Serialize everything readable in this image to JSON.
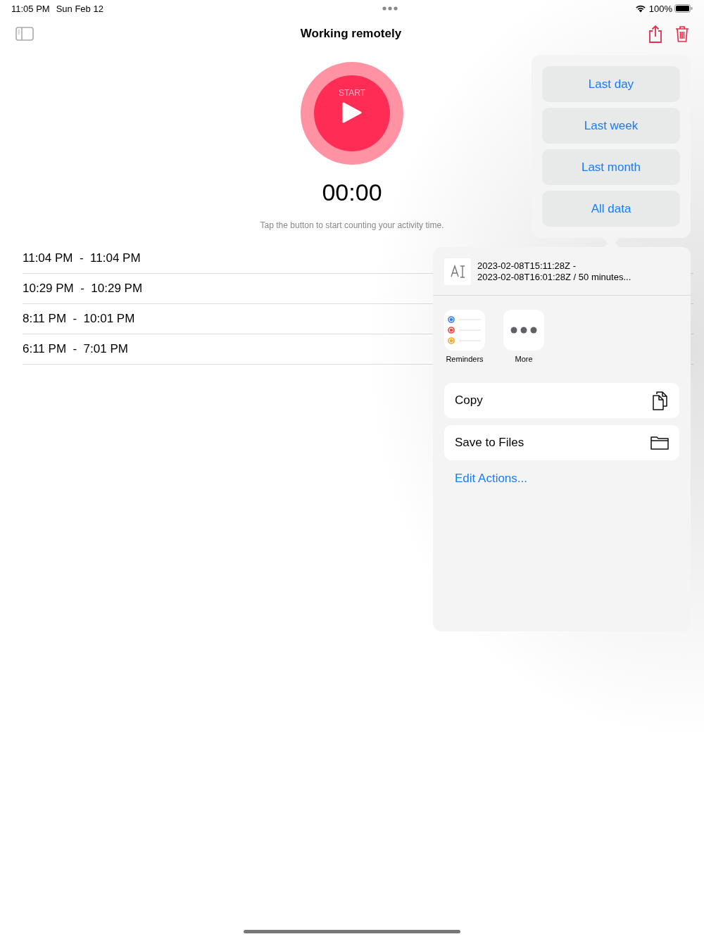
{
  "status_bar": {
    "time": "11:05 PM",
    "date": "Sun Feb 12",
    "battery": "100%"
  },
  "nav": {
    "title": "Working remotely"
  },
  "timer": {
    "button_label": "START",
    "elapsed": "00:00",
    "hint": "Tap the button to start counting your activity time."
  },
  "sessions": [
    {
      "label": "11:04 PM  -  11:04 PM"
    },
    {
      "label": "10:29 PM  -  10:29 PM"
    },
    {
      "label": "8:11 PM  -  10:01 PM"
    },
    {
      "label": "6:11 PM  -  7:01 PM"
    }
  ],
  "export_menu": {
    "options": [
      "Last day",
      "Last week",
      "Last month",
      "All data"
    ]
  },
  "share_sheet": {
    "preview_lines": [
      "2023-02-08T15:11:28Z -",
      "2023-02-08T16:01:28Z / 50 minutes..."
    ],
    "apps": [
      {
        "label": "Reminders",
        "kind": "reminders"
      },
      {
        "label": "More",
        "kind": "more"
      }
    ],
    "actions": [
      {
        "label": "Copy",
        "kind": "copy"
      },
      {
        "label": "Save to Files",
        "kind": "folder"
      }
    ],
    "edit_link": "Edit Actions..."
  }
}
